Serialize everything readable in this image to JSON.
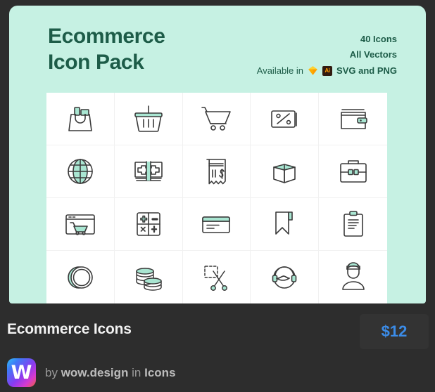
{
  "hero": {
    "title": "Ecommerce\nIcon Pack",
    "meta": {
      "icons_count": "40 Icons",
      "vectors": "All Vectors",
      "available_label": "Available in",
      "formats": "SVG and PNG",
      "sketch_badge": "sketch-diamond-icon",
      "ai_badge": "Ai"
    },
    "colors": {
      "background": "#c6f1e3",
      "title": "#1d5c48",
      "sheet": "#ffffff",
      "grid_line": "#f1f1f1",
      "icon_stroke": "#3a3a3a",
      "icon_accent": "#a9e6d2"
    }
  },
  "icon_sheet": {
    "columns": 5,
    "rows": 4,
    "icons": [
      {
        "name": "shopping-bag-icon",
        "label": "Shopping bag"
      },
      {
        "name": "shopping-basket-icon",
        "label": "Shopping basket"
      },
      {
        "name": "shopping-cart-icon",
        "label": "Shopping cart"
      },
      {
        "name": "discount-percent-card-icon",
        "label": "Discount card"
      },
      {
        "name": "wallet-icon",
        "label": "Wallet"
      },
      {
        "name": "globe-icon",
        "label": "Global commerce"
      },
      {
        "name": "cash-banknotes-icon",
        "label": "Cash banknotes"
      },
      {
        "name": "receipt-dollar-icon",
        "label": "Receipt"
      },
      {
        "name": "open-box-icon",
        "label": "Open box"
      },
      {
        "name": "briefcase-icon",
        "label": "Briefcase"
      },
      {
        "name": "online-store-window-icon",
        "label": "Online store"
      },
      {
        "name": "calculator-icon",
        "label": "Calculator"
      },
      {
        "name": "credit-card-icon",
        "label": "Credit card"
      },
      {
        "name": "bookmark-icon",
        "label": "Bookmark"
      },
      {
        "name": "clipboard-list-icon",
        "label": "Clipboard"
      },
      {
        "name": "coin-ring-icon",
        "label": "Coin"
      },
      {
        "name": "coins-stack-icon",
        "label": "Coins stack"
      },
      {
        "name": "coupon-scissors-icon",
        "label": "Coupon cut"
      },
      {
        "name": "support-headset-icon",
        "label": "Customer support"
      },
      {
        "name": "user-avatar-icon",
        "label": "Customer"
      }
    ]
  },
  "info": {
    "item_title": "Ecommerce Icons",
    "price": "$12",
    "price_color": "#3b8ce8",
    "author": {
      "logo_letter": "W",
      "by_label": "by",
      "name": "wow.design",
      "in_label": "in",
      "category": "Icons"
    }
  }
}
